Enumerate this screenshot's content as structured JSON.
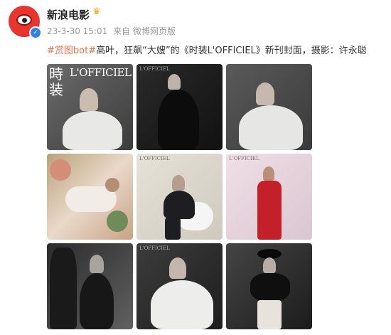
{
  "account": {
    "name": "新浪电影",
    "verified_mark": "✓",
    "crown_icon": "♛"
  },
  "post": {
    "time": "23-3-30 15:01",
    "source": "来自 微博网页版",
    "tag": "#赏图bot#",
    "text": "高叶，狂飙“大嫂”的《时装L'OFFICIEL》新刊封面，摄影：许永聪"
  },
  "photos": {
    "cover": {
      "title_line1": "時",
      "title_line2": "装",
      "brand": "L'OFFICIEL"
    },
    "watermark": "L'OFFICIEL"
  }
}
